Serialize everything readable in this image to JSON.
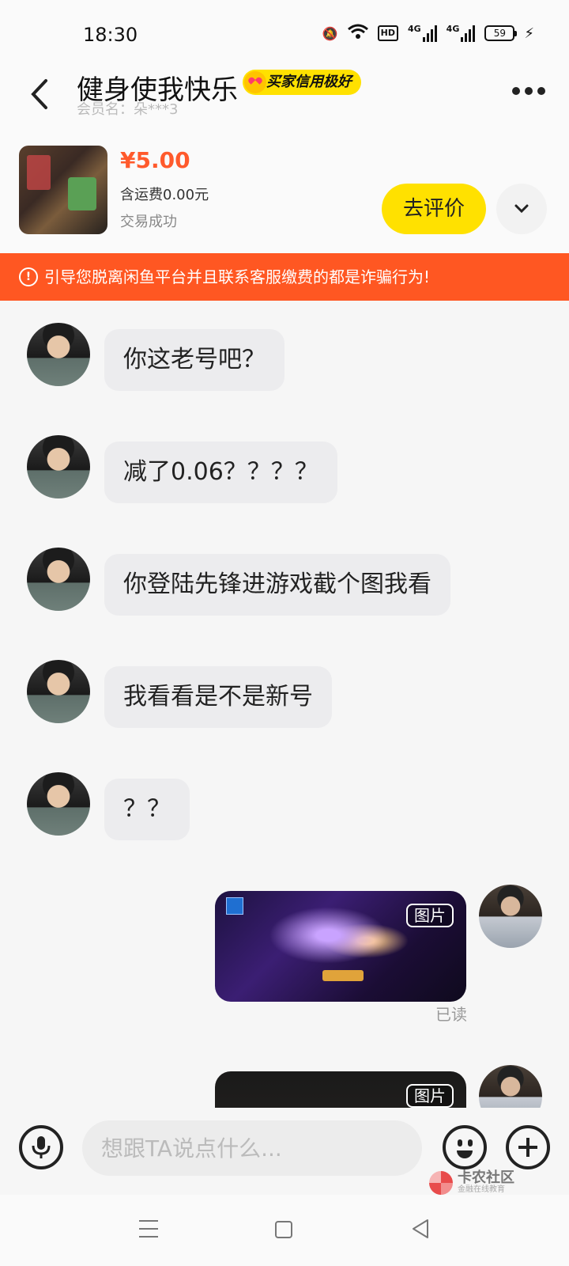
{
  "status_bar": {
    "time": "18:30",
    "network": "4G",
    "hd": "HD",
    "battery": "59"
  },
  "header": {
    "title": "健身使我快乐",
    "badge": "买家信用极好",
    "member_label": "会员名：朵***3"
  },
  "product": {
    "price": "¥5.00",
    "shipping": "含运费0.00元",
    "status": "交易成功",
    "review_button": "去评价"
  },
  "warning": {
    "icon": "!",
    "text": "引导您脱离闲鱼平台并且联系客服缴费的都是诈骗行为!"
  },
  "messages": [
    {
      "text": "你这老号吧？"
    },
    {
      "text": "减了0.06？？？？"
    },
    {
      "text": "你登陆先锋进游戏截个图我看"
    },
    {
      "text": "我看看是不是新号"
    },
    {
      "text": "？？"
    }
  ],
  "sent_images": [
    {
      "tag": "图片",
      "read": "已读"
    },
    {
      "tag": "图片"
    }
  ],
  "input": {
    "placeholder": "想跟TA说点什么..."
  },
  "watermark": {
    "title": "卡农社区",
    "subtitle": "金融在线教育"
  }
}
